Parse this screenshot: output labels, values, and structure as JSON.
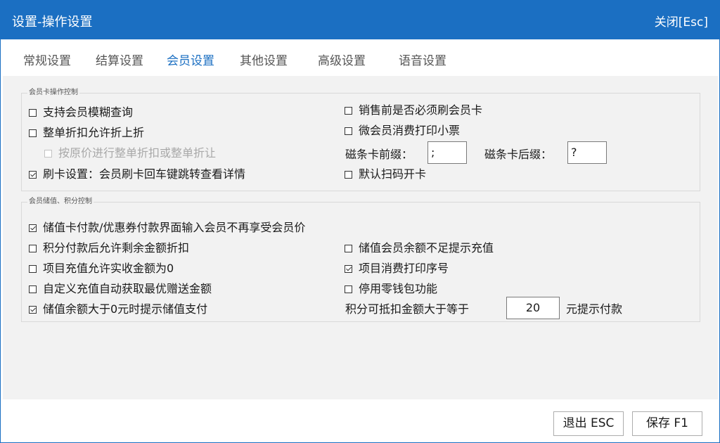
{
  "window": {
    "title": "设置-操作设置",
    "close_label": "关闭[Esc]"
  },
  "tabs": [
    {
      "label": "常规设置"
    },
    {
      "label": "结算设置"
    },
    {
      "label": "会员设置",
      "active": true
    },
    {
      "label": "其他设置"
    },
    {
      "label": "高级设置"
    },
    {
      "label": "语音设置"
    }
  ],
  "card_group": {
    "legend": "会员卡操作控制",
    "options": [
      {
        "label": "支持会员模糊查询",
        "checked": false
      },
      {
        "label": "整单折扣允许折上折",
        "checked": false
      },
      {
        "label": "按原价进行整单折扣或整单折让",
        "checked": false,
        "disabled": true
      },
      {
        "label": "刷卡设置：会员刷卡回车键跳转查看详情",
        "checked": true
      },
      {
        "label": "销售前是否必须刷会员卡",
        "checked": false
      },
      {
        "label": "微会员消费打印小票",
        "checked": false
      },
      {
        "label": "默认扫码开卡",
        "checked": false
      }
    ],
    "prefix_label": "磁条卡前缀：",
    "prefix_value": ";",
    "suffix_label": "磁条卡后缀：",
    "suffix_value": "?"
  },
  "stored_group": {
    "legend": "会员储值、积分控制",
    "options": [
      {
        "label": "储值卡付款/优惠券付款界面输入会员不再享受会员价",
        "checked": true
      },
      {
        "label": "积分付款后允许剩余金额折扣",
        "checked": false
      },
      {
        "label": "项目充值允许实收金额为0",
        "checked": false
      },
      {
        "label": "自定义充值自动获取最优赠送金额",
        "checked": false
      },
      {
        "label": "储值余额大于0元时提示储值支付",
        "checked": true
      },
      {
        "label": "储值会员余额不足提示充值",
        "checked": false
      },
      {
        "label": "项目消费打印序号",
        "checked": true
      },
      {
        "label": "停用零钱包功能",
        "checked": false
      }
    ],
    "points_label": "积分可抵扣金额大于等于",
    "points_value": "20",
    "points_suffix": "元提示付款"
  },
  "footer": {
    "exit_label": "退出 ESC",
    "save_label": "保存 F1"
  },
  "colors": {
    "accent": "#1b6fc2",
    "panel_bg": "#f2f2f2"
  }
}
